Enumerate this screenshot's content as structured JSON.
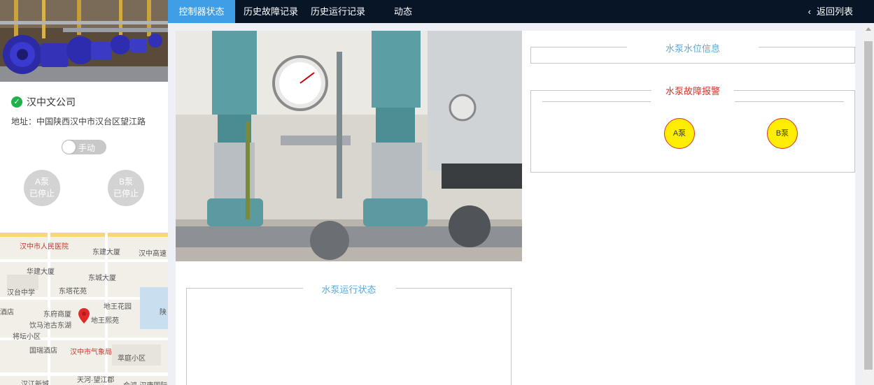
{
  "company": {
    "name": "汉中文公司",
    "address": "地址：中国陕西汉中市汉台区望江路"
  },
  "mode_toggle": {
    "label": "手动"
  },
  "pumps_status": [
    {
      "name": "A泵",
      "state": "已停止"
    },
    {
      "name": "B泵",
      "state": "已停止"
    }
  ],
  "nav": {
    "tabs": [
      "控制器状态",
      "历史故障记录",
      "历史运行记录",
      "动态"
    ],
    "back": "返回列表"
  },
  "panels": {
    "water_level": "水泵水位信息",
    "fault_alarm": "水泵故障报警",
    "run_status": "水泵运行状态"
  },
  "alarms": [
    "A泵",
    "B泵"
  ],
  "map_labels": [
    "汉中市人民医院",
    "东建大厦",
    "汉中高速",
    "华建大厦",
    "东城大厦",
    "汉台中学",
    "东塔花苑",
    "地王花园",
    "东府商厦",
    "饮马池古东湖",
    "地王熙苑",
    "将坛小区",
    "国瑞酒店",
    "汉中市气象局",
    "萃庭小区",
    "天河·望江郡",
    "汉江新城",
    "合鸿·汉唐国际",
    "酒店",
    "陕"
  ],
  "colors": {
    "nav_bg": "#081527",
    "active_tab": "#409ee6",
    "alarm_fill": "#ffee00",
    "alarm_border": "#d9302b",
    "ok_green": "#21b24b"
  }
}
